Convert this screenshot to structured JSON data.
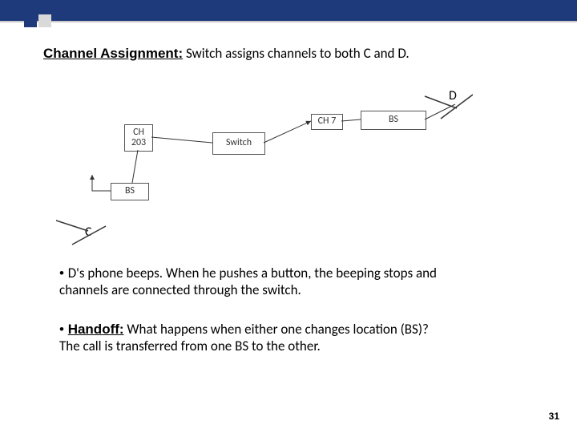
{
  "heading": {
    "label": "Channel Assignment:",
    "rest": "  Switch assigns channels to both C and D."
  },
  "diagram": {
    "ch_left_l1": "CH",
    "ch_left_l2": "203",
    "bs_left": "BS",
    "node_c": "C",
    "switch": "Switch",
    "ch_right": "CH 7",
    "bs_right": "BS",
    "node_d": "D"
  },
  "body1": {
    "l1a": "• ",
    "l1b": "D's phone beeps. When he pushes a button, the beeping stops and",
    "l2": "channels are connected through the switch."
  },
  "body2": {
    "l1a": "• ",
    "l1b": "Handoff:",
    "l1c": " What happens when either one changes location (BS)?",
    "l2": "The call is transferred from one BS to the other."
  },
  "page": "31"
}
